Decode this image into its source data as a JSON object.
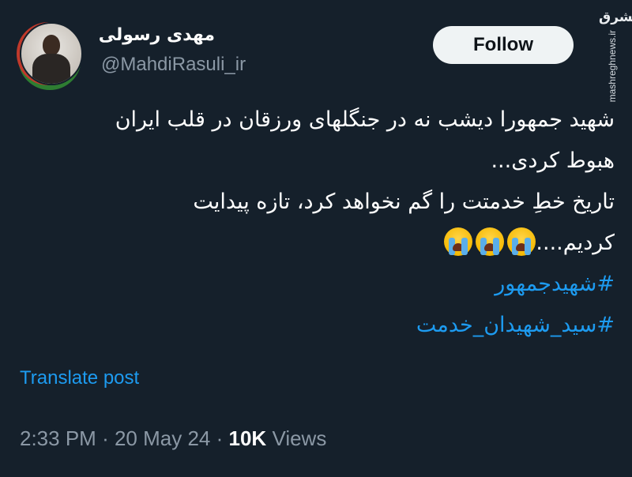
{
  "author": {
    "name": "مهدی رسولی",
    "handle": "@MahdiRasuli_ir",
    "avatar_icon": "profile-photo"
  },
  "follow_button": {
    "label": "Follow"
  },
  "watermark": {
    "logo": "مشرق",
    "site": "mashreghnews.ir"
  },
  "post": {
    "lines": [
      "شهید جمهورا دیشب نه در جنگلهای ورزقان در قلب ایران",
      "هبوط کردی...",
      "تاریخ خطِ خدمتت را گم نخواهد کرد، تازه پیدایت",
      "کردیم...."
    ],
    "emojis": [
      "loudly-crying-face",
      "loudly-crying-face",
      "loudly-crying-face"
    ],
    "hashtags": [
      "#شهیدجمهور",
      "#سید_شهیدان_خدمت"
    ]
  },
  "translate_link": "Translate post",
  "meta": {
    "time": "2:33 PM",
    "separator": "·",
    "date": "20 May 24",
    "views_count": "10K",
    "views_label": "Views"
  },
  "colors": {
    "background": "#15202b",
    "link": "#1d9bf0",
    "secondary_text": "#8b98a5",
    "button_bg": "#eff3f4"
  }
}
